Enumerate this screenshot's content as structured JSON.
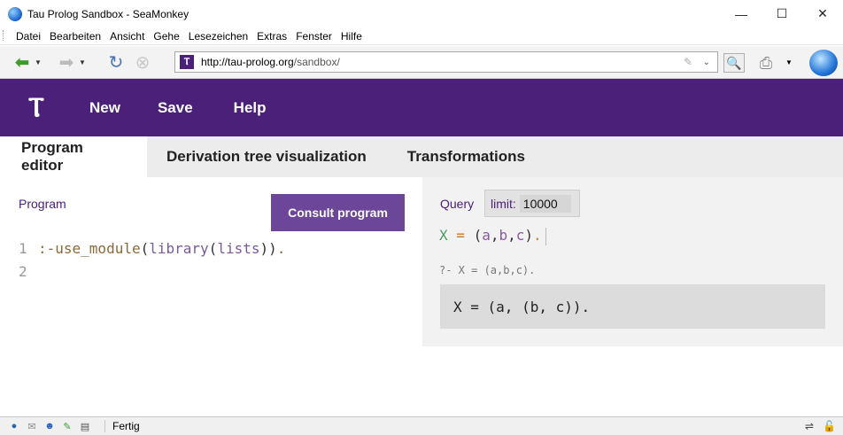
{
  "window": {
    "title": "Tau Prolog Sandbox - SeaMonkey"
  },
  "menu": [
    "Datei",
    "Bearbeiten",
    "Ansicht",
    "Gehe",
    "Lesezeichen",
    "Extras",
    "Fenster",
    "Hilfe"
  ],
  "navbar": {
    "url_prefix": "http://tau-prolog.org",
    "url_path": "/sandbox/"
  },
  "app": {
    "logo": "Ⲧ",
    "nav": {
      "new": "New",
      "save": "Save",
      "help": "Help"
    },
    "tabs": {
      "editor": "Program editor",
      "tree": "Derivation tree visualization",
      "transformations": "Transformations"
    }
  },
  "program": {
    "label": "Program",
    "consult_label": "Consult program",
    "lines": [
      {
        "n": "1",
        "text": ":-use_module(library(lists))."
      },
      {
        "n": "2",
        "text": ""
      }
    ]
  },
  "query": {
    "label": "Query",
    "limit_label": "limit:",
    "limit_value": "10000",
    "input": "X = (a,b,c).",
    "echo": "?- X = (a,b,c).",
    "answer": "X = (a, (b, c))."
  },
  "status": {
    "text": "Fertig"
  }
}
